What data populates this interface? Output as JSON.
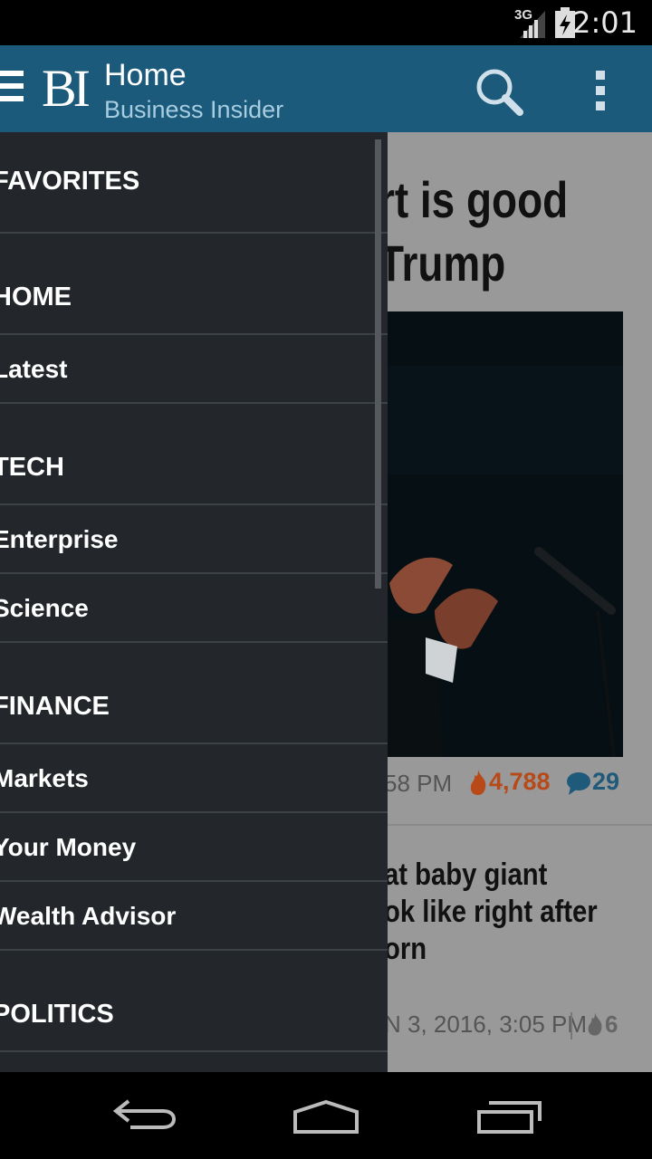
{
  "status_bar": {
    "network": "3G",
    "time": "2:01"
  },
  "action_bar": {
    "logo": "BI",
    "title": "Home",
    "subtitle": "Business Insider",
    "color": "#1b5a7a"
  },
  "drawer": {
    "items": [
      {
        "label": "FAVORITES",
        "type": "section"
      },
      {
        "label": "HOME",
        "type": "section"
      },
      {
        "label": "Latest",
        "type": "sub"
      },
      {
        "label": "TECH",
        "type": "section"
      },
      {
        "label": "Enterprise",
        "type": "sub"
      },
      {
        "label": "Science",
        "type": "sub"
      },
      {
        "label": "FINANCE",
        "type": "section"
      },
      {
        "label": "Markets",
        "type": "sub"
      },
      {
        "label": "Your Money",
        "type": "sub"
      },
      {
        "label": "Wealth Advisor",
        "type": "sub"
      },
      {
        "label": "POLITICS",
        "type": "section"
      }
    ]
  },
  "articles": [
    {
      "headline_line1": "rt is good",
      "headline_line2": "Trump",
      "time": "58 PM",
      "views": "4,788",
      "comments": "29"
    },
    {
      "headline_line1": "at baby giant",
      "headline_line2": "ok like right after",
      "headline_line3": "orn",
      "time": "N 3, 2016, 3:05 PM",
      "views": "6"
    }
  ]
}
